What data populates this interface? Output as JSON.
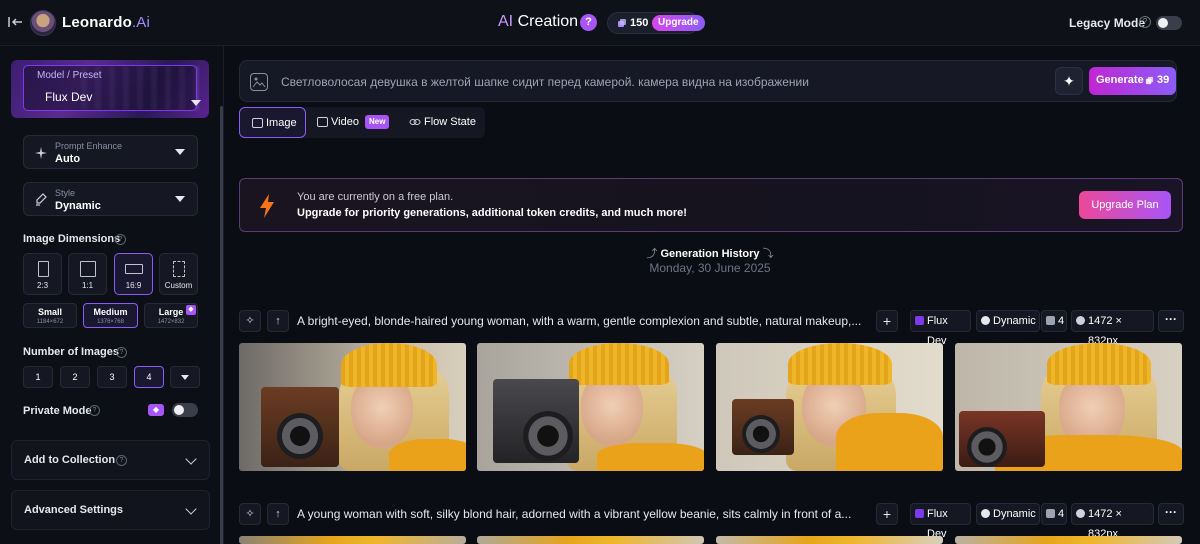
{
  "header": {
    "brand_name": "Leonardo",
    "brand_suffix": ".Ai",
    "title_prefix": "AI",
    "title_rest": " Creation",
    "help_badge": "?",
    "tokens": "150",
    "upgrade_label": "Upgrade",
    "legacy_mode_label": "Legacy Mode"
  },
  "sidebar": {
    "model_label": "Model / Preset",
    "model_value": "Flux Dev",
    "prompt_enhance_label": "Prompt Enhance",
    "prompt_enhance_value": "Auto",
    "style_label": "Style",
    "style_value": "Dynamic",
    "image_dimensions_label": "Image Dimensions",
    "aspect_ratios": [
      "2:3",
      "1:1",
      "16:9",
      "Custom"
    ],
    "sizes": [
      {
        "label": "Small",
        "dims": "1184×672"
      },
      {
        "label": "Medium",
        "dims": "1376×768"
      },
      {
        "label": "Large",
        "dims": "1472×832"
      }
    ],
    "number_of_images_label": "Number of Images",
    "image_counts": [
      "1",
      "2",
      "3",
      "4"
    ],
    "private_mode_label": "Private Mode",
    "add_to_collection_label": "Add to Collection",
    "advanced_settings_label": "Advanced Settings"
  },
  "prompt": {
    "text": "Светловолосая девушка в желтой шапке сидит перед камерой. камера видна на изображении",
    "generate_label": "Generate",
    "generate_cost": "39"
  },
  "tabs": {
    "image": "Image",
    "video": "Video",
    "video_badge": "New",
    "flow_state": "Flow State"
  },
  "banner": {
    "line1": "You are currently on a free plan.",
    "line2": "Upgrade for priority generations, additional token credits, and much more!",
    "button": "Upgrade Plan"
  },
  "history": {
    "title": "Generation History",
    "date": "Monday, 30 June 2025"
  },
  "generations": [
    {
      "prompt": "A bright-eyed, blonde-haired young woman, with a warm, gentle complexion and subtle, natural makeup,...",
      "model": "Flux Dev",
      "style": "Dynamic",
      "count": "4",
      "dimensions": "1472 × 832px"
    },
    {
      "prompt": "A young woman with soft, silky blond hair, adorned with a vibrant yellow beanie, sits calmly in front of a...",
      "model": "Flux Dev",
      "style": "Dynamic",
      "count": "4",
      "dimensions": "1472 × 832px"
    }
  ],
  "colors": {
    "accent": "#8b5cf6",
    "brand_gradient_start": "#c026d3",
    "banner_bolt": "#f97316"
  }
}
